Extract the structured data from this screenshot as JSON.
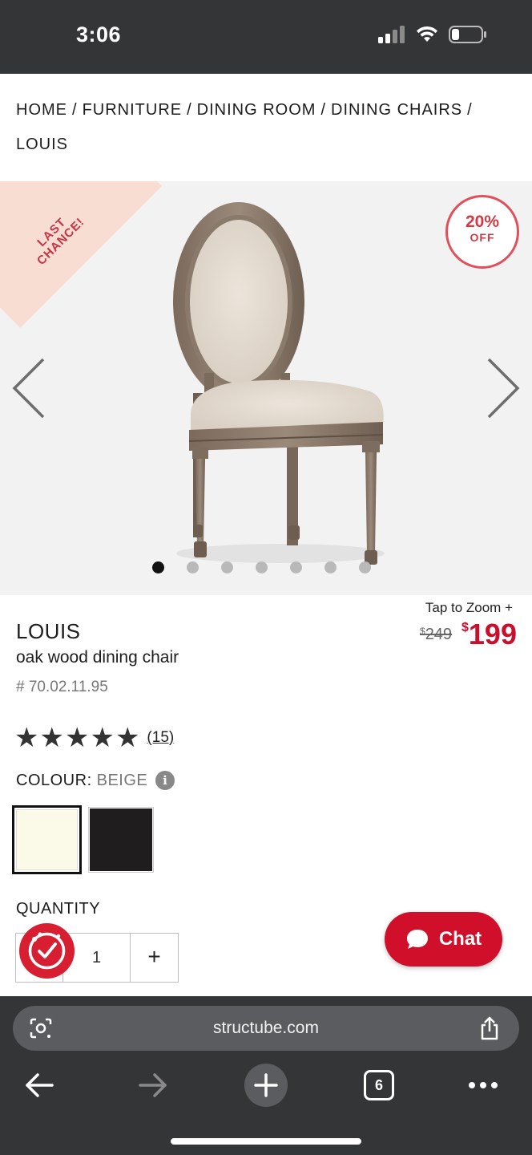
{
  "status_bar": {
    "time": "3:06"
  },
  "breadcrumb": {
    "items": [
      "HOME",
      "FURNITURE",
      "DINING ROOM",
      "DINING CHAIRS",
      "LOUIS"
    ],
    "separator": "/"
  },
  "hero": {
    "ribbon_line1": "LAST",
    "ribbon_line2": "CHANCE!",
    "badge_percent": "20%",
    "badge_off": "OFF",
    "image_count": 7,
    "active_image": 1
  },
  "product": {
    "tap_to_zoom": "Tap to Zoom +",
    "name": "LOUIS",
    "description": "oak wood dining chair",
    "sku": "# 70.02.11.95",
    "price_old_symbol": "$",
    "price_old": "249",
    "price_new_symbol": "$",
    "price_new": "199",
    "rating_stars": 5,
    "review_count": "(15)",
    "colour_label": "COLOUR:",
    "colour_value": "BEIGE",
    "swatches": [
      {
        "name": "beige",
        "color": "#fbfae8",
        "selected": true
      },
      {
        "name": "black",
        "color": "#1f1d1d",
        "selected": false
      }
    ],
    "quantity_label": "QUANTITY",
    "quantity_value": "1",
    "plus": "+"
  },
  "chat": {
    "label": "Chat"
  },
  "browser": {
    "url": "structube.com",
    "tab_count": "6"
  },
  "colors": {
    "accent_red": "#d0102a",
    "chrome_dark": "#333537"
  }
}
